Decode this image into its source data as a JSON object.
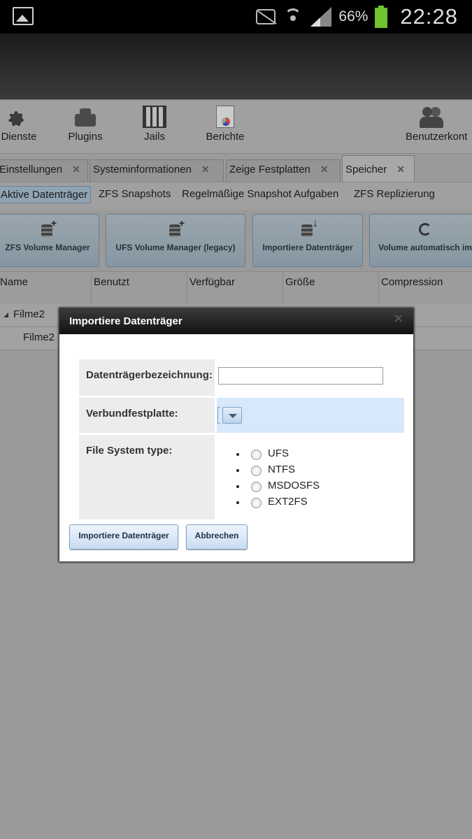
{
  "statusbar": {
    "battery": "66%",
    "time": "22:28",
    "colors": {
      "battery": "#6fc32e"
    }
  },
  "toolbar": {
    "items": [
      {
        "label": "Dienste",
        "icon": "gear-icon"
      },
      {
        "label": "Plugins",
        "icon": "plugin-icon"
      },
      {
        "label": "Jails",
        "icon": "jails-icon"
      },
      {
        "label": "Berichte",
        "icon": "report-icon"
      },
      {
        "label": "Benutzerkont",
        "icon": "users-icon"
      }
    ]
  },
  "tabs": [
    {
      "label": "Einstellungen"
    },
    {
      "label": "Systeminformationen"
    },
    {
      "label": "Zeige Festplatten"
    },
    {
      "label": "Speicher",
      "active": true
    }
  ],
  "subtabs": [
    {
      "label": "Aktive Datenträger",
      "active": true
    },
    {
      "label": "ZFS Snapshots"
    },
    {
      "label": "Regelmäßige Snapshot Aufgaben"
    },
    {
      "label": "ZFS Replizierung"
    }
  ],
  "actions": [
    {
      "label": "ZFS Volume Manager"
    },
    {
      "label": "UFS Volume Manager (legacy)"
    },
    {
      "label": "Importiere Datenträger"
    },
    {
      "label": "Volume automatisch im"
    }
  ],
  "grid": {
    "columns": [
      "Name",
      "Benutzt",
      "Verfügbar",
      "Größe",
      "Compression"
    ],
    "rows": [
      {
        "name": "Filme2"
      },
      {
        "name": "Filme2"
      }
    ]
  },
  "dialog": {
    "title": "Importiere Datenträger",
    "fields": {
      "label_name": "Datenträgerbezeichnung:",
      "name_value": "",
      "label_disk": "Verbundfestplatte:",
      "label_fs": "File System type:"
    },
    "fs_options": [
      "UFS",
      "NTFS",
      "MSDOSFS",
      "EXT2FS"
    ],
    "buttons": {
      "import": "Importiere Datenträger",
      "cancel": "Abbrechen"
    },
    "colors": {
      "selected_row": "#d7e8fa"
    }
  }
}
